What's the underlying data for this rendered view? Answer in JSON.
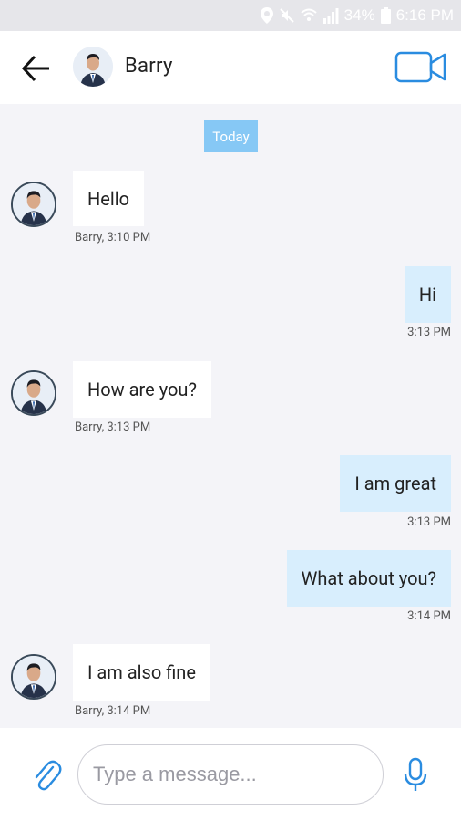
{
  "status_bar": {
    "battery": "34%",
    "time": "6:16 PM",
    "icons": [
      "location-icon",
      "mute-icon",
      "wifi-icon",
      "signal-icon",
      "battery-icon"
    ]
  },
  "header": {
    "contact_name": "Barry",
    "back_icon": "arrow-left-icon",
    "video_icon": "video-camera-icon"
  },
  "conversation": {
    "date_label": "Today",
    "messages": [
      {
        "direction": "in",
        "text": "Hello",
        "meta": "Barry, 3:10 PM"
      },
      {
        "direction": "out",
        "text": "Hi",
        "meta": "3:13 PM"
      },
      {
        "direction": "in",
        "text": "How are you?",
        "meta": "Barry, 3:13 PM"
      },
      {
        "direction": "out",
        "text": "I am great",
        "meta": "3:13 PM"
      },
      {
        "direction": "out",
        "text": "What about you?",
        "meta": "3:14 PM"
      },
      {
        "direction": "in",
        "text": "I am also fine",
        "meta": "Barry, 3:14 PM"
      }
    ]
  },
  "composer": {
    "placeholder": "Type a message...",
    "value": "",
    "attach_icon": "paperclip-icon",
    "mic_icon": "microphone-icon"
  },
  "colors": {
    "accent": "#2a8ce0",
    "date_chip": "#86c8f5",
    "outgoing_bubble": "#d8eefd",
    "incoming_bubble": "#ffffff",
    "background": "#f4f4f8"
  }
}
